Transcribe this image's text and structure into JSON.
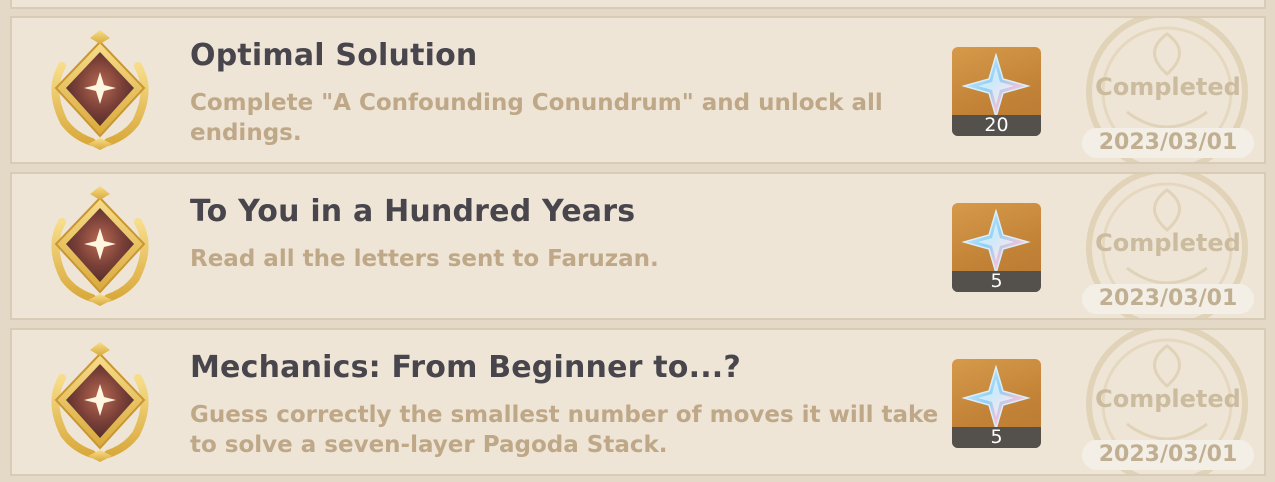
{
  "achievements": [
    {
      "title": "Optimal Solution",
      "description": "Complete \"A Confounding Conundrum\" and unlock all endings.",
      "reward_count": "20",
      "reward_icon": "primogem-icon",
      "status": "Completed",
      "date": "2023/03/01"
    },
    {
      "title": "To You in a Hundred Years",
      "description": "Read all the letters sent to Faruzan.",
      "reward_count": "5",
      "reward_icon": "primogem-icon",
      "status": "Completed",
      "date": "2023/03/01"
    },
    {
      "title": "Mechanics: From Beginner to...?",
      "description": "Guess correctly the smallest number of moves it will take to solve a seven-layer Pagoda Stack.",
      "reward_count": "5",
      "reward_icon": "primogem-icon",
      "status": "Completed",
      "date": "2023/03/01"
    }
  ],
  "colors": {
    "card_bg": "#eee5d6",
    "title": "#48464c",
    "description": "#bfa887",
    "reward_bg": "#c18136",
    "status_text": "#cbbc9f"
  }
}
